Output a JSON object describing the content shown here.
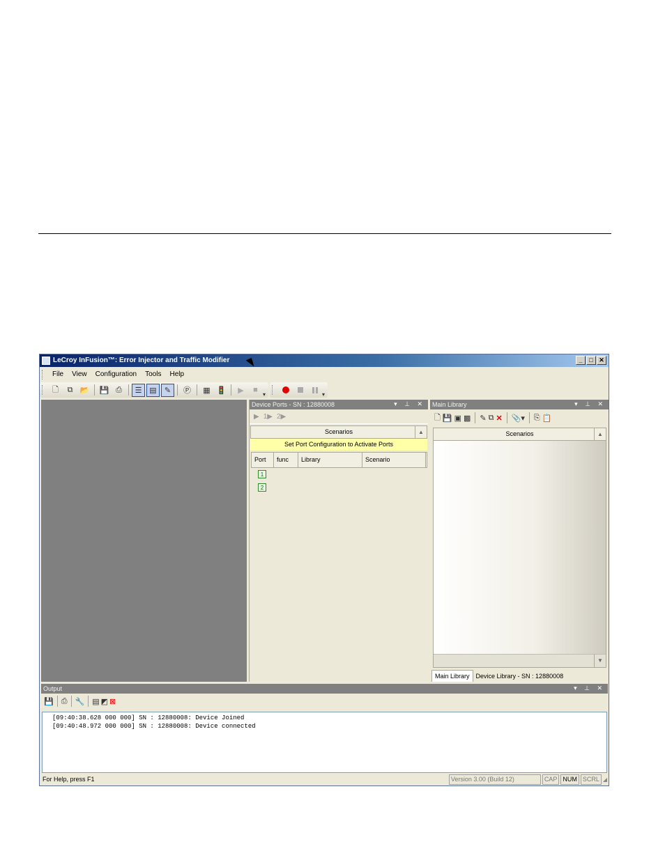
{
  "window": {
    "title": "LeCroy InFusion™: Error Injector and Traffic Modifier",
    "controls": [
      "_",
      "□",
      "✕"
    ]
  },
  "menu": [
    "File",
    "View",
    "Configuration",
    "Tools",
    "Help"
  ],
  "device_ports": {
    "title": "Device Ports - SN : 12880008",
    "port_tool_1": "1",
    "port_tool_2": "2",
    "scenarios_header": "Scenarios",
    "notice": "Set Port Configuration to Activate Ports",
    "columns": [
      "Port",
      "func",
      "Library",
      "Scenario"
    ],
    "ports": [
      "1",
      "2"
    ]
  },
  "main_library": {
    "title": "Main Library",
    "scenarios_header": "Scenarios",
    "tabs": [
      "Main Library",
      "Device Library - SN : 12880008"
    ]
  },
  "output": {
    "title": "Output",
    "log": [
      "[09:40:38.628 000 000] SN : 12880008: Device Joined",
      "[09:40:48.972 000 000] SN : 12880008: Device connected"
    ]
  },
  "status": {
    "help": "For Help, press F1",
    "version": "Version 3.00 (Build 12)",
    "cap": "CAP",
    "num": "NUM",
    "scrl": "SCRL"
  },
  "colors": {
    "title_start": "#0a246a",
    "title_end": "#a6caf0",
    "notice_bg": "#ffffa8",
    "record": "#e00000"
  }
}
